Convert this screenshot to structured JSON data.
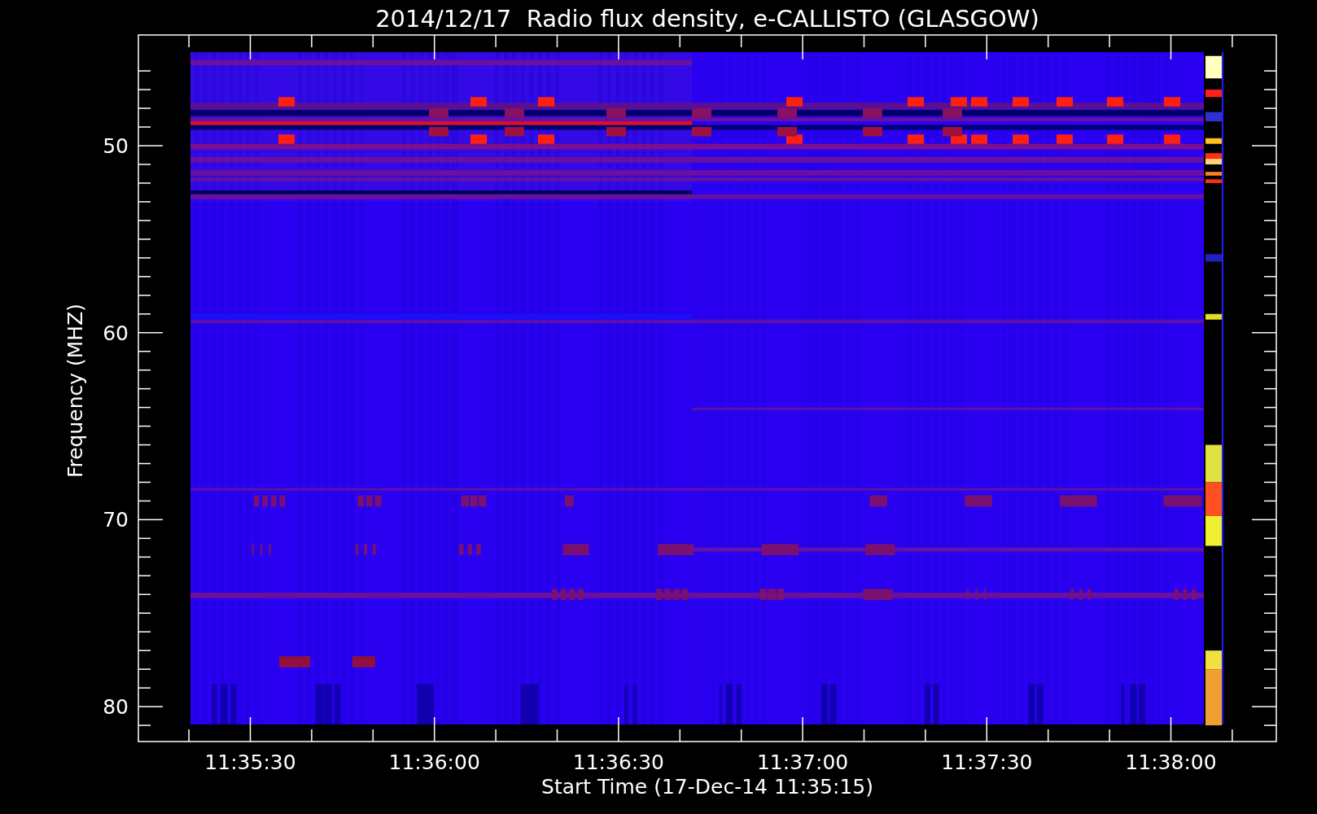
{
  "title": "2014/12/17  Radio flux density, e-CALLISTO (GLASGOW)",
  "y_axis": {
    "label": "Frequency (MHZ)",
    "tick_labels": [
      "50",
      "60",
      "70",
      "80"
    ]
  },
  "x_axis": {
    "label": "Start Time (17-Dec-14 11:35:15)",
    "tick_labels": [
      "11:35:30",
      "11:36:00",
      "11:36:30",
      "11:37:00",
      "11:37:30",
      "11:38:00"
    ]
  }
}
